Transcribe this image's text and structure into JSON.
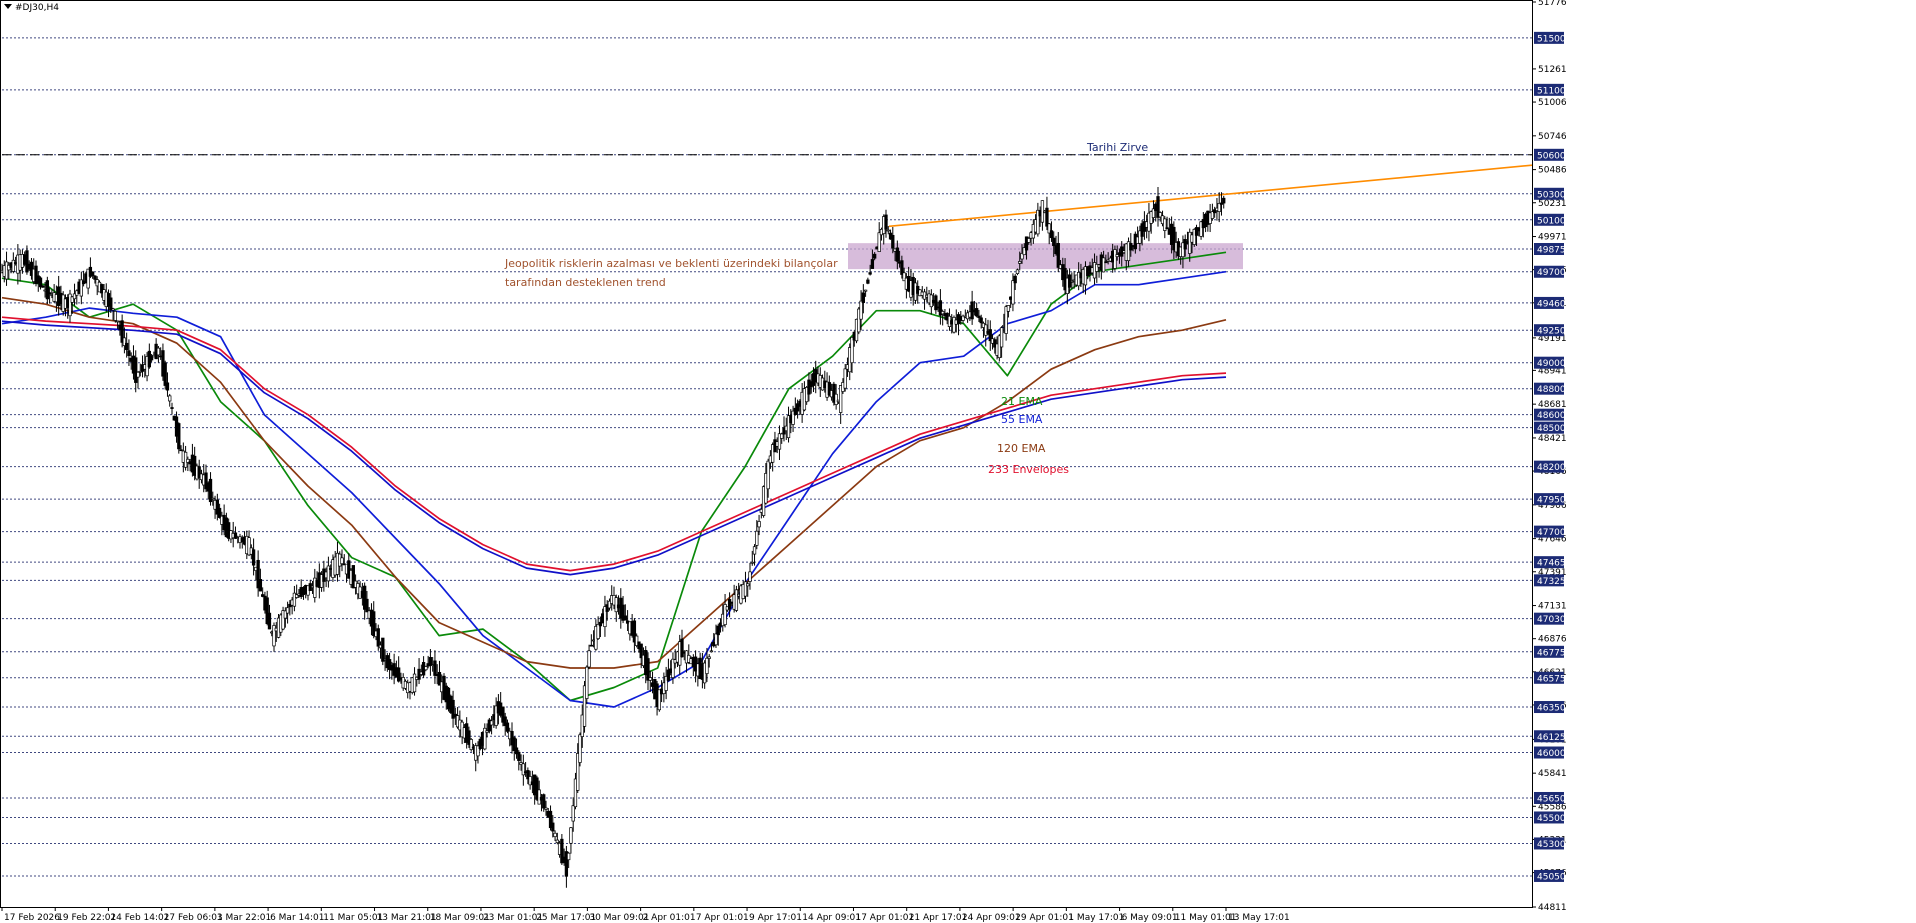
{
  "window": {
    "title": "#DJ30,H4",
    "collapse_icon": "triangle-down-icon"
  },
  "colors": {
    "price": "#000000",
    "grid": "#1f2a6b",
    "ema21": "#0a8a0a",
    "ema55": "#0f1ed8",
    "ema120": "#8b3a12",
    "envelope_upper": "#e0102e",
    "envelope_lower": "#1010c8",
    "trendline": "#ff8c00",
    "zone": "#c9a6cf",
    "ath_line": "#000000",
    "tag_bg": "#1c2b75"
  },
  "chart_data": {
    "type": "line",
    "symbol": "#DJ30",
    "timeframe": "H4",
    "ylim": [
      44811,
      51776
    ],
    "x": [
      "17 Feb 2026",
      "19 Feb 22:01",
      "24 Feb 14:01",
      "27 Feb 06:01",
      "3 Mar 22:01",
      "6 Mar 14:01",
      "11 Mar 05:01",
      "13 Mar 21:01",
      "18 Mar 09:01",
      "23 Mar 01:01",
      "25 Mar 17:01",
      "30 Mar 09:01",
      "2 Apr 01:01",
      "7 Apr 01:01",
      "9 Apr 17:01",
      "14 Apr 09:01",
      "17 Apr 01:01",
      "21 Apr 17:01",
      "24 Apr 09:01",
      "29 Apr 01:01",
      "1 May 17:01",
      "6 May 09:01",
      "11 May 01:01",
      "13 May 17:01"
    ],
    "price_ticks": [
      51776,
      51261,
      51006,
      50746,
      50486,
      50231,
      49971,
      49716,
      49461,
      49191,
      48941,
      48681,
      48421,
      48166,
      47906,
      47646,
      47391,
      47131,
      46876,
      46621,
      46366,
      46101,
      45841,
      45586,
      45331,
      45076,
      44811
    ],
    "levels": [
      51500,
      51100,
      50600,
      50300,
      50100,
      49875,
      49700,
      49460,
      49250,
      49000,
      48800,
      48600,
      48500,
      48200,
      47950,
      47700,
      47465,
      47325,
      47030,
      46775,
      46575,
      46350,
      46125,
      46000,
      45650,
      45500,
      45300,
      45050
    ],
    "series": [
      {
        "name": "21 EMA",
        "values": [
          49650,
          49600,
          49350,
          49450,
          49250,
          48700,
          48400,
          47900,
          47500,
          47350,
          46900,
          46950,
          46700,
          46400,
          46500,
          46650,
          47700,
          48200,
          48800,
          49050,
          49400,
          49400,
          49300,
          48900,
          49450,
          49700,
          49750,
          49800,
          49850
        ]
      },
      {
        "name": "55 EMA",
        "values": [
          49300,
          49350,
          49420,
          49380,
          49350,
          49200,
          48600,
          48300,
          48000,
          47650,
          47300,
          46900,
          46650,
          46400,
          46350,
          46500,
          46700,
          47300,
          47800,
          48300,
          48700,
          49000,
          49050,
          49300,
          49400,
          49600,
          49600,
          49650,
          49700
        ]
      },
      {
        "name": "120 EMA",
        "values": [
          49500,
          49450,
          49350,
          49300,
          49150,
          48850,
          48400,
          48050,
          47750,
          47350,
          47000,
          46850,
          46700,
          46650,
          46650,
          46700,
          47000,
          47300,
          47600,
          47900,
          48200,
          48400,
          48500,
          48700,
          48950,
          49100,
          49200,
          49250,
          49330
        ]
      },
      {
        "name": "233 Envelopes",
        "values": [
          49350,
          49320,
          49300,
          49280,
          49250,
          49100,
          48800,
          48600,
          48350,
          48050,
          47800,
          47600,
          47450,
          47400,
          47450,
          47550,
          47700,
          47850,
          48000,
          48150,
          48300,
          48450,
          48550,
          48650,
          48750,
          48800,
          48850,
          48900,
          48920
        ]
      }
    ],
    "close": [
      49700,
      49800,
      49550,
      49450,
      49700,
      49400,
      48900,
      49100,
      48300,
      48100,
      47700,
      47600,
      46900,
      47200,
      47300,
      47500,
      47200,
      46700,
      46500,
      46700,
      46300,
      46000,
      46350,
      45900,
      45600,
      45100,
      46800,
      47200,
      46900,
      46400,
      46800,
      46600,
      47100,
      47300,
      48300,
      48600,
      48900,
      48700,
      49450,
      50100,
      49600,
      49500,
      49300,
      49400,
      49100,
      49800,
      50200,
      49600,
      49700,
      49800,
      49900,
      50200,
      49850,
      50050,
      50250
    ],
    "annotations": [
      {
        "text": "Tarihi Zirve",
        "color": "#1c2b75"
      },
      {
        "text": "Jeopolitik risklerin azalması ve beklenti üzerindeki bilançolar",
        "color": "#a0522d"
      },
      {
        "text": "tarafından desteklenen trend",
        "color": "#a0522d"
      },
      {
        "text": "21 EMA",
        "color": "#0a8a0a"
      },
      {
        "text": "55 EMA",
        "color": "#0f1ed8"
      },
      {
        "text": "120 EMA",
        "color": "#8b3a12"
      },
      {
        "text": "233 Envelopes",
        "color": "#e0102e"
      }
    ],
    "ath_level": 50600,
    "zone": [
      49720,
      49920
    ],
    "trendline": [
      [
        50050,
        50320
      ],
      [
        50520
      ]
    ],
    "grid": false,
    "legend": "none"
  }
}
